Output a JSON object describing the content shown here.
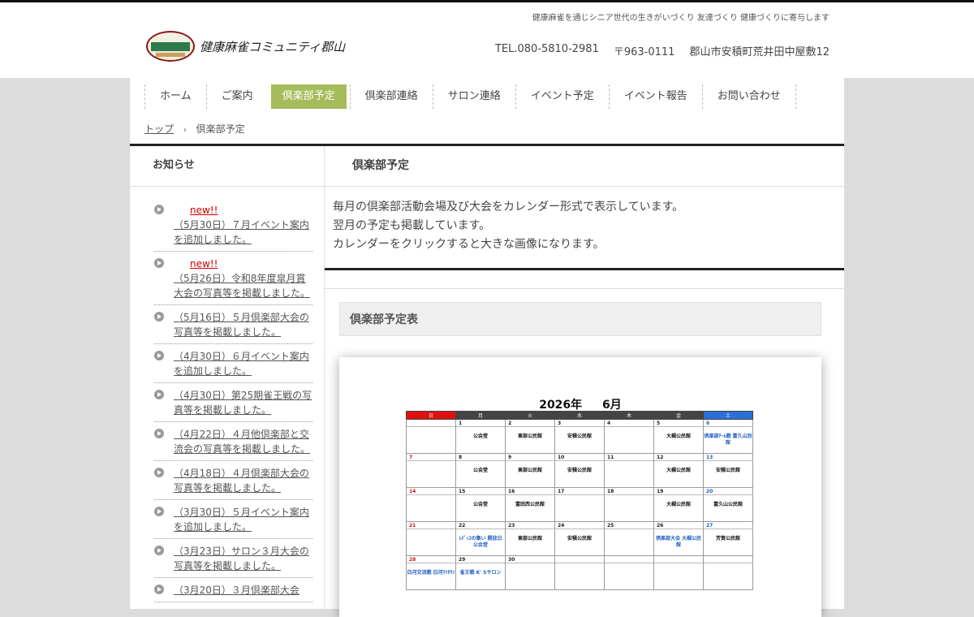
{
  "header": {
    "tagline": "健康麻雀を通じシニア世代の生きがいづくり 友達づくり 健康づくりに寄与します",
    "logo_text": "健康麻雀コミュニティ郡山",
    "tel": "TEL.080-5810-2981",
    "zip": "〒963-0111",
    "address": "郡山市安積町荒井田中屋敷12"
  },
  "nav": {
    "items": [
      "ホーム",
      "ご案内",
      "倶楽部予定",
      "倶楽部連絡",
      "サロン連絡",
      "イベント予定",
      "イベント報告",
      "お問い合わせ"
    ],
    "active_index": 2
  },
  "breadcrumb": {
    "home": "トップ",
    "sep": "›",
    "current": "倶楽部予定"
  },
  "sidebar": {
    "title": "お知らせ",
    "news": [
      {
        "new": "new!!",
        "text": "（5月30日）７月イベント案内を追加しました。"
      },
      {
        "new": "new!!",
        "text": "（5月26日）令和8年度皐月賞大会の写真等を掲載しました。"
      },
      {
        "new": "",
        "text": "（5月16日）５月倶楽部大会の写真等を掲載しました。"
      },
      {
        "new": "",
        "text": "（4月30日）６月イベント案内を追加しました。"
      },
      {
        "new": "",
        "text": "（4月30日）第25期雀王戦の写真等を掲載しました。"
      },
      {
        "new": "",
        "text": "（4月22日）４月他倶楽部と交流会の写真等を掲載しました。"
      },
      {
        "new": "",
        "text": "（4月18日）４月倶楽部大会の写真等を掲載しました。"
      },
      {
        "new": "",
        "text": "（3月30日）５月イベント案内を追加しました。"
      },
      {
        "new": "",
        "text": "（3月23日）サロン３月大会の写真等を掲載しました。"
      },
      {
        "new": "",
        "text": "（3月20日）３月倶楽部大会"
      }
    ]
  },
  "main": {
    "title": "倶楽部予定",
    "intro": [
      "毎月の倶楽部活動会場及び大会をカレンダー形式で表示しています。",
      "翌月の予定も掲載しています。",
      "カレンダーをクリックすると大きな画像になります。"
    ],
    "section_title": "倶楽部予定表"
  },
  "calendar": {
    "year": "2026年",
    "month": "6月",
    "weekdays": [
      "日",
      "月",
      "火",
      "水",
      "木",
      "金",
      "土"
    ],
    "weeks": [
      [
        {
          "d": "",
          "e": ""
        },
        {
          "d": "1",
          "e": "公会堂"
        },
        {
          "d": "2",
          "e": "東部公民館"
        },
        {
          "d": "3",
          "e": "安積公民館"
        },
        {
          "d": "4",
          "e": ""
        },
        {
          "d": "5",
          "e": "大槻公民館"
        },
        {
          "d": "6",
          "e": "倶楽部ﾁｰﾑ戦 富久山別館",
          "blue": true
        }
      ],
      [
        {
          "d": "7",
          "e": ""
        },
        {
          "d": "8",
          "e": "公会堂"
        },
        {
          "d": "9",
          "e": "東部公民館"
        },
        {
          "d": "10",
          "e": "安積公民館"
        },
        {
          "d": "11",
          "e": ""
        },
        {
          "d": "12",
          "e": "大槻公民館"
        },
        {
          "d": "13",
          "e": "安積公民館"
        }
      ],
      [
        {
          "d": "14",
          "e": ""
        },
        {
          "d": "15",
          "e": "公会堂"
        },
        {
          "d": "16",
          "e": "富田西公民館"
        },
        {
          "d": "17",
          "e": ""
        },
        {
          "d": "18",
          "e": ""
        },
        {
          "d": "19",
          "e": "大槻公民館"
        },
        {
          "d": "20",
          "e": "富久山公民館"
        }
      ],
      [
        {
          "d": "21",
          "e": ""
        },
        {
          "d": "22",
          "e": "ﾚﾃﾞｨｽの集い 開放日 公会堂",
          "blue": true
        },
        {
          "d": "23",
          "e": "東部公民館"
        },
        {
          "d": "24",
          "e": "安積公民館"
        },
        {
          "d": "25",
          "e": ""
        },
        {
          "d": "26",
          "e": "倶楽部大会 大槻公民館",
          "blue": true
        },
        {
          "d": "27",
          "e": "芳賀公民館"
        }
      ],
      [
        {
          "d": "28",
          "e": "白河交流戦 白河ﾏｲﾀｳﾝ",
          "blue": true
        },
        {
          "d": "29",
          "e": "雀王戦 K' Sサロン",
          "blue": true
        },
        {
          "d": "30",
          "e": ""
        },
        {
          "d": "",
          "e": ""
        },
        {
          "d": "",
          "e": ""
        },
        {
          "d": "",
          "e": ""
        },
        {
          "d": "",
          "e": ""
        }
      ]
    ]
  }
}
